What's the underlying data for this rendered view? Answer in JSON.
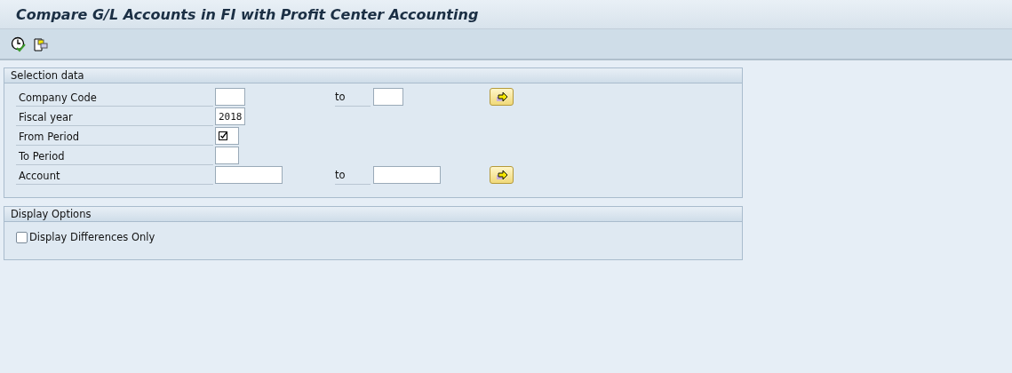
{
  "window": {
    "title": "Compare G/L Accounts in FI with Profit Center Accounting"
  },
  "toolbar": {
    "buttons": [
      {
        "kind": "execute"
      },
      {
        "kind": "variants"
      }
    ]
  },
  "groups": [
    {
      "title": "Selection data",
      "rows": [
        {
          "kind": "range",
          "label": "Company Code",
          "value": "",
          "required": false,
          "to_label": "to",
          "to_value": ""
        },
        {
          "kind": "single",
          "label": "Fiscal year",
          "value": "2018",
          "required": false
        },
        {
          "kind": "single",
          "label": "From Period",
          "value": "",
          "required": true
        },
        {
          "kind": "single",
          "label": "To Period",
          "value": "",
          "required": false
        },
        {
          "kind": "range",
          "label": "Account",
          "value": "",
          "required": false,
          "to_label": "to",
          "to_value": ""
        }
      ]
    },
    {
      "title": "Display Options",
      "rows": [
        {
          "kind": "checkbox",
          "label": "Display Differences Only",
          "checked": false
        }
      ]
    }
  ]
}
